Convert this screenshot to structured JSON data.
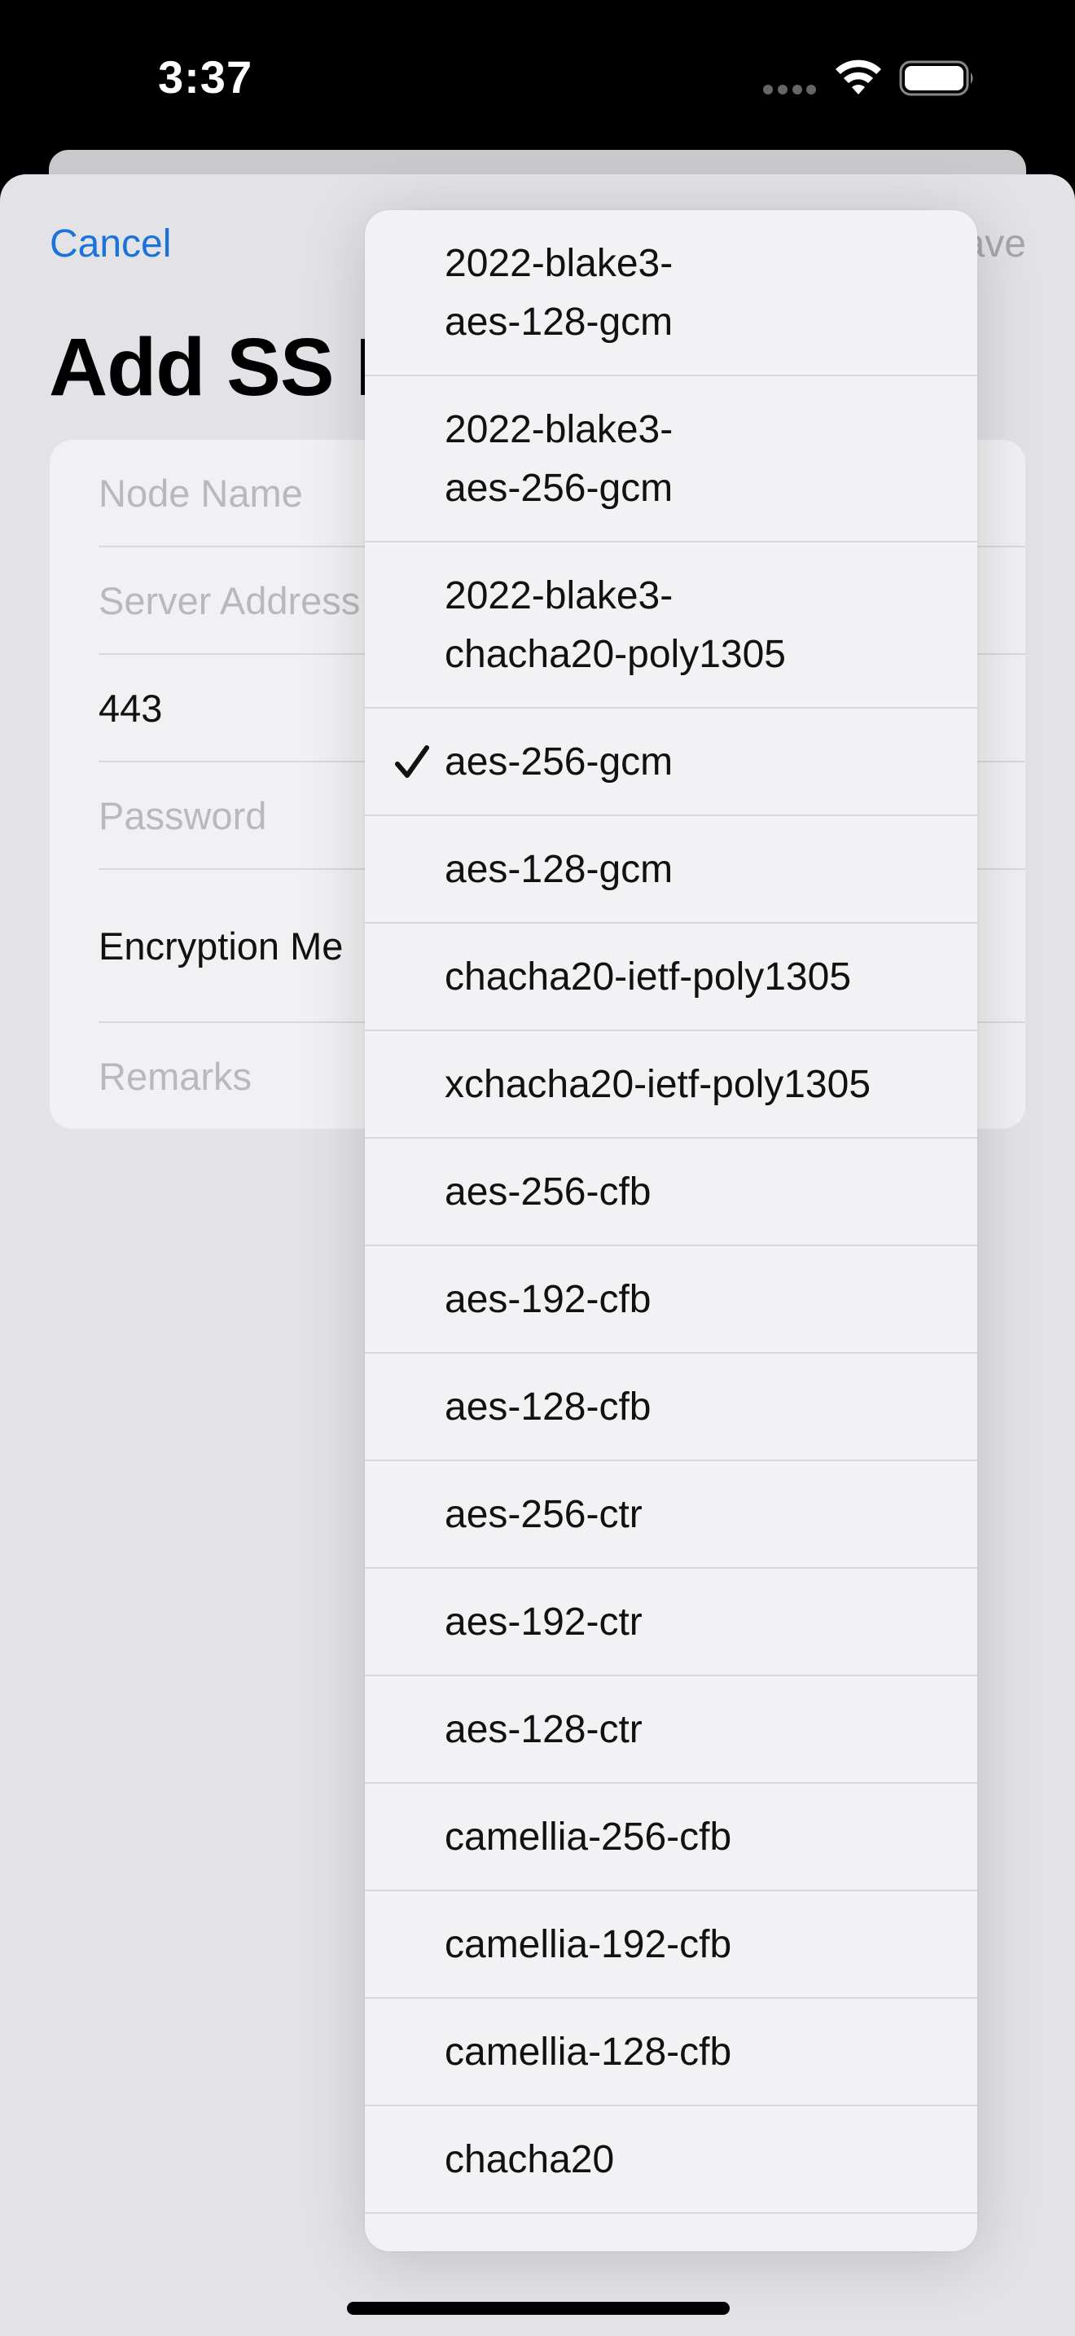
{
  "status_bar": {
    "time": "3:37",
    "icons": [
      "signal-dots-icon",
      "wifi-icon",
      "battery-icon"
    ]
  },
  "nav": {
    "cancel_label": "Cancel",
    "save_label": "ave"
  },
  "title": "Add SS N",
  "form": {
    "rows": [
      {
        "label": "Node Name",
        "kind": "placeholder"
      },
      {
        "label": "Server Address",
        "kind": "placeholder"
      },
      {
        "label": "443",
        "kind": "value"
      },
      {
        "label": "Password",
        "kind": "placeholder"
      },
      {
        "label": "Encryption Me",
        "kind": "value"
      },
      {
        "label": "Remarks",
        "kind": "placeholder"
      }
    ]
  },
  "menu": {
    "selected": "aes-256-gcm",
    "items": [
      {
        "line1": "2022-blake3-",
        "line2": "aes-128-gcm",
        "checked": false
      },
      {
        "line1": "2022-blake3-",
        "line2": "aes-256-gcm",
        "checked": false
      },
      {
        "line1": "2022-blake3-",
        "line2": "chacha20-poly1305",
        "checked": false
      },
      {
        "line1": "aes-256-gcm",
        "checked": true
      },
      {
        "line1": "aes-128-gcm",
        "checked": false
      },
      {
        "line1": "chacha20-ietf-poly1305",
        "checked": false
      },
      {
        "line1": "xchacha20-ietf-poly1305",
        "checked": false
      },
      {
        "line1": "aes-256-cfb",
        "checked": false
      },
      {
        "line1": "aes-192-cfb",
        "checked": false
      },
      {
        "line1": "aes-128-cfb",
        "checked": false
      },
      {
        "line1": "aes-256-ctr",
        "checked": false
      },
      {
        "line1": "aes-192-ctr",
        "checked": false
      },
      {
        "line1": "aes-128-ctr",
        "checked": false
      },
      {
        "line1": "camellia-256-cfb",
        "checked": false
      },
      {
        "line1": "camellia-192-cfb",
        "checked": false
      },
      {
        "line1": "camellia-128-cfb",
        "checked": false
      },
      {
        "line1": "chacha20",
        "checked": false
      }
    ]
  },
  "colors": {
    "accent": "#1a73d9",
    "placeholder": "#b9b9bd"
  }
}
